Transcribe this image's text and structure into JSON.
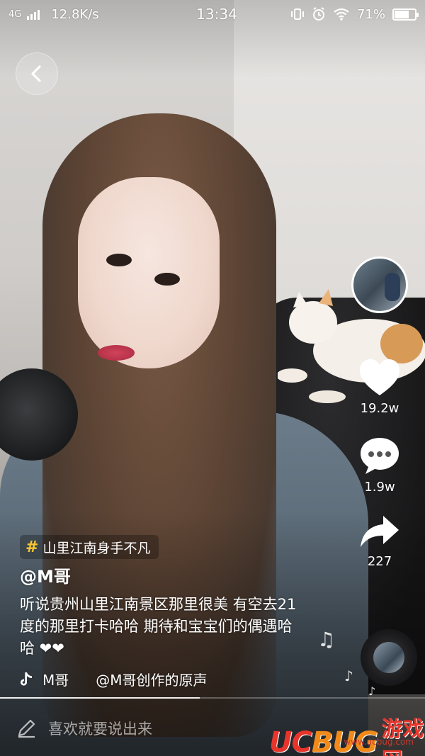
{
  "status_bar": {
    "network": "4G",
    "speed": "12.8K/s",
    "time": "13:34",
    "battery": "71%",
    "battery_level": 0.71,
    "icons": [
      "signal-icon",
      "vibrate-icon",
      "alarm-icon",
      "wifi-icon",
      "battery-icon"
    ]
  },
  "nav": {
    "back_icon": "chevron-left-icon"
  },
  "actions": {
    "like": {
      "icon": "heart-icon",
      "count": "19.2w"
    },
    "comment": {
      "icon": "comment-icon",
      "count": "1.9w"
    },
    "share": {
      "icon": "share-icon",
      "count": "227"
    }
  },
  "video": {
    "tag": "山里江南身手不凡",
    "author": "@M哥",
    "description": "听说贵州山里江南景区那里很美  有空去21度的那里打卡哈哈 期待和宝宝们的偶遇哈哈 ❤❤",
    "music_author": "M哥",
    "music_title": "@M哥创作的原声",
    "progress": 0.47
  },
  "comment_input": {
    "placeholder": "喜欢就要说出来",
    "icon": "pencil-icon"
  },
  "watermark": {
    "uc": "UC",
    "bug": "BUG",
    "cn": "游戏网",
    "url": "www.ucbug.com"
  },
  "colors": {
    "tag_hash": "#f7c630",
    "watermark_red": "#e8352b",
    "watermark_orange": "#f28a1a"
  }
}
